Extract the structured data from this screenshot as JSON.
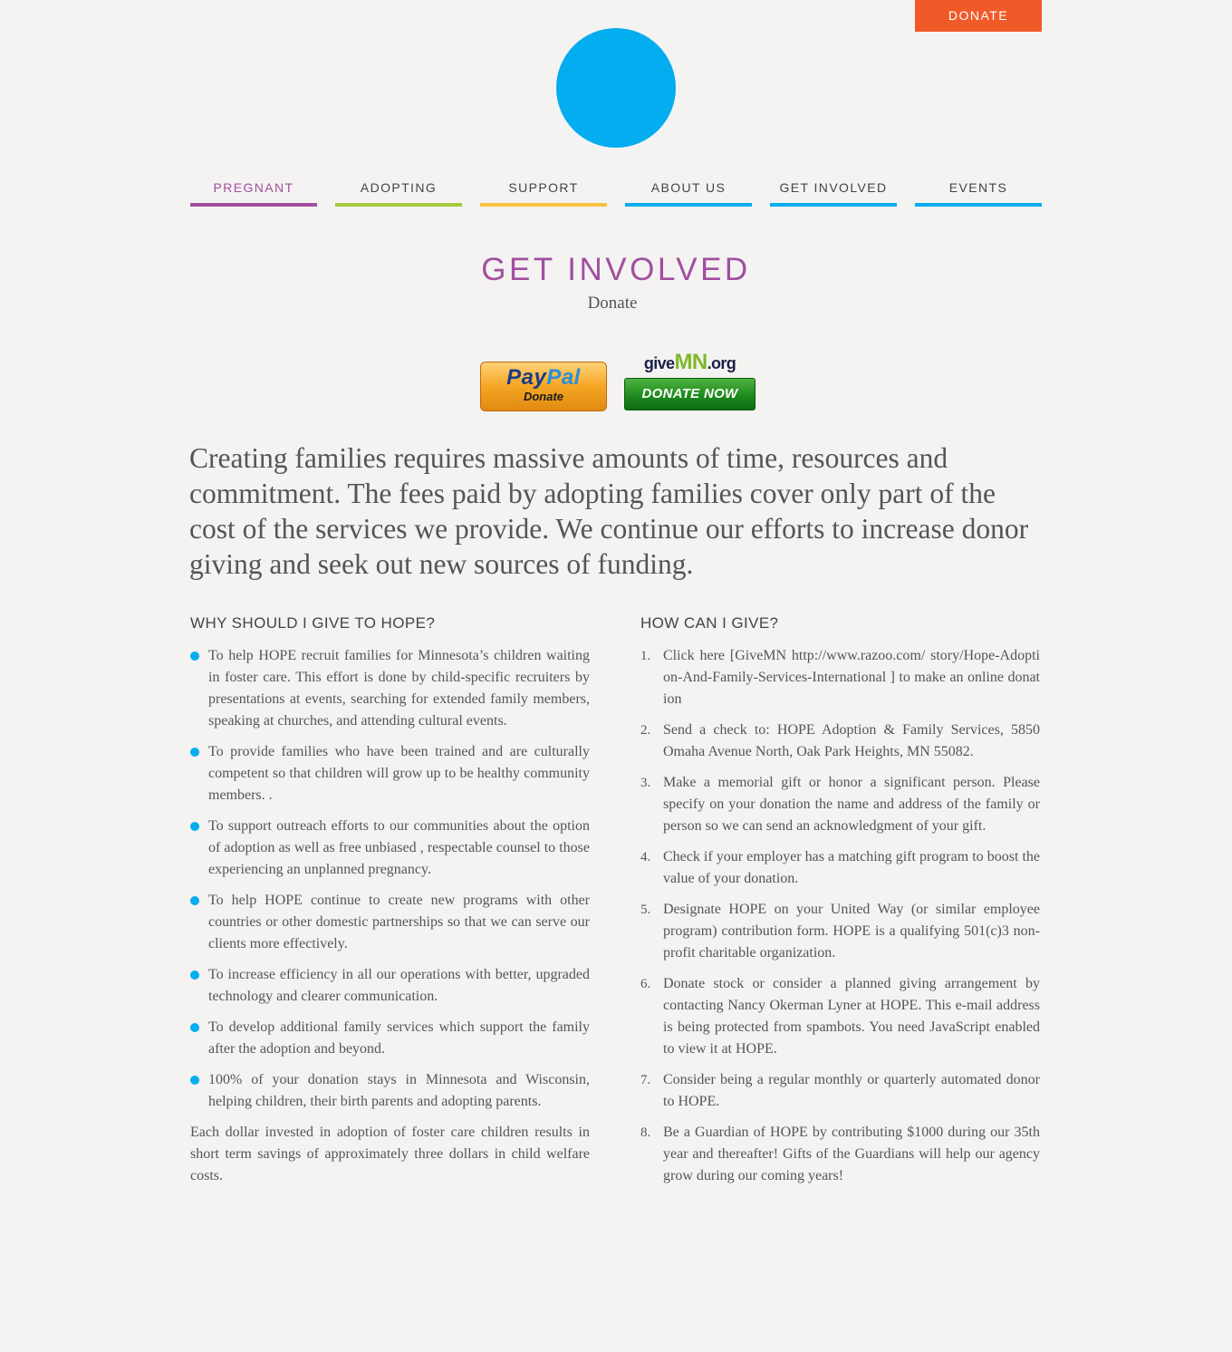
{
  "header": {
    "donate_button": "DONATE"
  },
  "colors": {
    "brand_blue": "#03adef",
    "donate_orange": "#f05a28",
    "title_purple": "#a24ea0",
    "pregnant_purple": "#a24ea0",
    "adopting_green": "#a6ca3c",
    "support_yellow": "#f7c23f",
    "nav_blue": "#03adef",
    "background": "#f4f3f1"
  },
  "nav": {
    "items": [
      {
        "label": "PREGNANT",
        "color": "#a24ea0",
        "text_color": "#a24ea0"
      },
      {
        "label": "ADOPTING",
        "color": "#a6ca3c",
        "text_color": "#444444"
      },
      {
        "label": "SUPPORT",
        "color": "#f7c23f",
        "text_color": "#444444"
      },
      {
        "label": "ABOUT US",
        "color": "#03adef",
        "text_color": "#444444"
      },
      {
        "label": "GET INVOLVED",
        "color": "#03adef",
        "text_color": "#444444"
      },
      {
        "label": "EVENTS",
        "color": "#03adef",
        "text_color": "#444444"
      }
    ]
  },
  "page": {
    "title": "GET INVOLVED",
    "subtitle": "Donate"
  },
  "donate_buttons": {
    "paypal": {
      "word_pay": "Pay",
      "word_pal": "Pal",
      "sub": "Donate"
    },
    "givemn": {
      "logo_give": "give",
      "logo_mn": "MN",
      "logo_org": ".org",
      "button": "DONATE NOW"
    }
  },
  "lead": "Creating families requires massive amounts of time, resources and commitment. The fees paid by adopting families cover only part of the cost of the services we provide. We continue our efforts to increase donor giving and seek out new sources of funding.",
  "why_give": {
    "heading": "WHY SHOULD I GIVE TO HOPE?",
    "bullets": [
      "To help HOPE recruit families for Minnesota’s children waiting in foster care.  This effort is done by child-specific recruiters by presentations at events, searching for extended family members, speaking at churches, and attending cultural events.",
      "To provide families who have been trained and are culturally competent so that children will grow up to be healthy community members.  .",
      "To support outreach efforts to our communities about the option of adoption as well as free unbiased , respectable counsel to those experiencing an unplanned pregnancy.",
      "To help HOPE continue to create new programs with other countries or other domestic partnerships so that we can serve our clients more effectively.",
      "To increase efficiency in all our operations with better, upgraded technology and clearer communication.",
      "To develop additional family services which support the family after the adoption and beyond.",
      "100% of your donation stays in Minnesota and Wisconsin, helping children, their birth parents and adopting parents."
    ],
    "closing": "Each dollar invested in adoption of foster care children results in short term savings of approximately three dollars in child welfare costs."
  },
  "how_give": {
    "heading": "HOW CAN I GIVE?",
    "steps": [
      {
        "num": "1.",
        "text": "Click here [GiveMN http://www.razoo.com/ story/Hope-Adoption-And-Family-Services-International ] to make an online donation"
      },
      {
        "num": "2.",
        "text": "Send a check to: HOPE Adoption & Family Services, 5850 Omaha Avenue North, Oak Park Heights, MN 55082."
      },
      {
        "num": "3.",
        "text": "Make a memorial gift or honor a significant person.  Please specify on your donation the name and address of the family or person so we can  send an acknowledgment of your gift."
      },
      {
        "num": "4.",
        "text": "Check if your employer has a matching gift program to boost the value of your donation."
      },
      {
        "num": "5.",
        "text": "Designate HOPE on your United Way (or similar employee program) contribution form. HOPE is a qualifying 501(c)3 non-profit charitable organization."
      },
      {
        "num": "6.",
        "text": "Donate stock or consider a planned giving arrangement by contacting Nancy Okerman Lyner at HOPE. This e-mail address is being protected from spambots. You need JavaScript enabled to view it at HOPE."
      },
      {
        "num": "7.",
        "text": "Consider being a regular monthly or quarterly automated donor to HOPE."
      },
      {
        "num": "8.",
        "text": "Be a Guardian of HOPE by contributing $1000 during our 35th year and thereafter!  Gifts of the Guardians will help our agency grow during our coming years!"
      }
    ]
  }
}
